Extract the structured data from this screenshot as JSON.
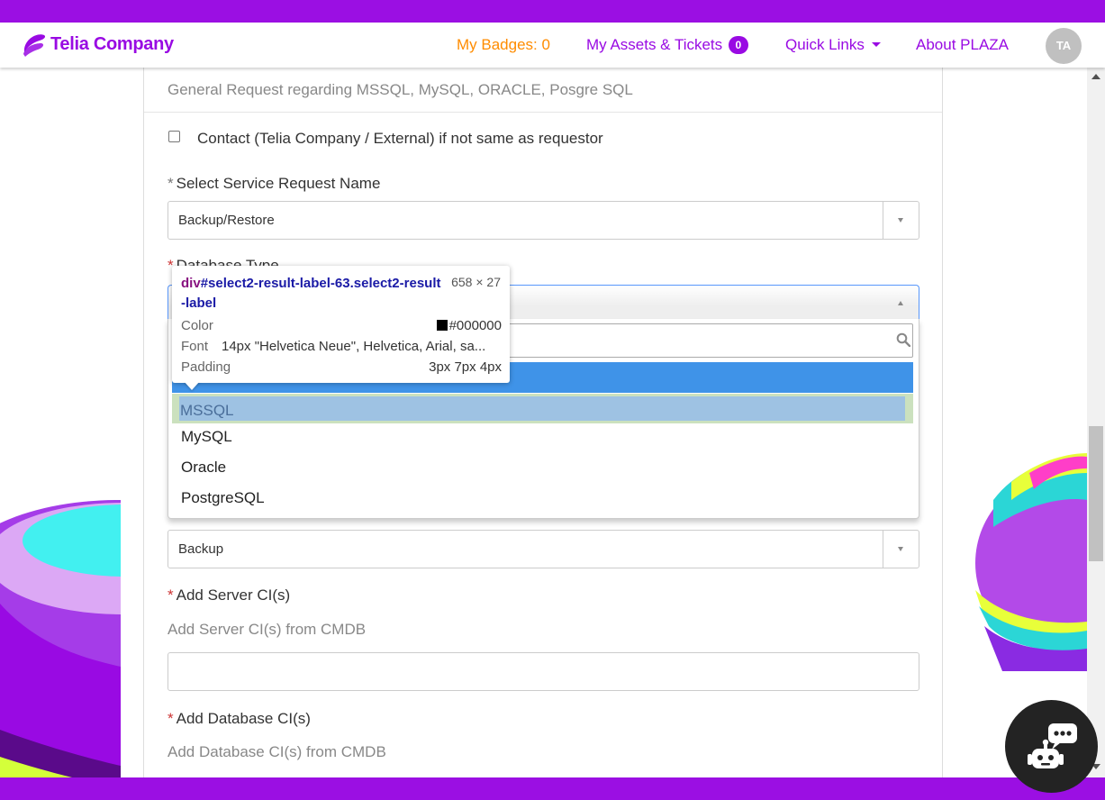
{
  "header": {
    "logo_text": "Telia Company",
    "nav": {
      "badges_label": "My Badges: 0",
      "assets_label": "My Assets & Tickets",
      "assets_count": "0",
      "quick_links_label": "Quick Links",
      "about_label": "About PLAZA"
    },
    "avatar_initials": "TA"
  },
  "form": {
    "general_request": "General Request regarding MSSQL, MySQL, ORACLE, Posgre SQL",
    "contact_checkbox_label": "Contact (Telia Company / External) if not same as requestor",
    "service_request": {
      "asterisk": "*",
      "label": "Select Service Request Name",
      "value": "Backup/Restore"
    },
    "database_type": {
      "asterisk": "*",
      "label": "Database Type",
      "options": [
        "MSSQL",
        "MySQL",
        "Oracle",
        "PostgreSQL"
      ],
      "selected_option": "MSSQL"
    },
    "backup_select": {
      "value": "Backup"
    },
    "server_ci": {
      "asterisk": "*",
      "label": "Add Server CI(s)",
      "hint": "Add Server CI(s) from CMDB"
    },
    "database_ci": {
      "asterisk": "*",
      "label": "Add Database CI(s)",
      "hint": "Add Database CI(s) from CMDB"
    }
  },
  "inspector_tooltip": {
    "tag": "div",
    "selector": "#select2-result-label-63.select2-result-label",
    "size": "658 × 27",
    "color_key": "Color",
    "color_value": "#000000",
    "font_key": "Font",
    "font_value": "14px \"Helvetica Neue\", Helvetica, Arial, sa...",
    "padding_key": "Padding",
    "padding_value": "3px 7px 4px"
  },
  "colors": {
    "brand": "#990ae3",
    "badges_orange": "#ff8c00",
    "required_red": "#cc3333",
    "highlight_blue": "#3f93e8"
  },
  "icons": {
    "search": "search-icon",
    "chatbot": "chatbot-icon",
    "caret": "chevron-down-icon"
  }
}
